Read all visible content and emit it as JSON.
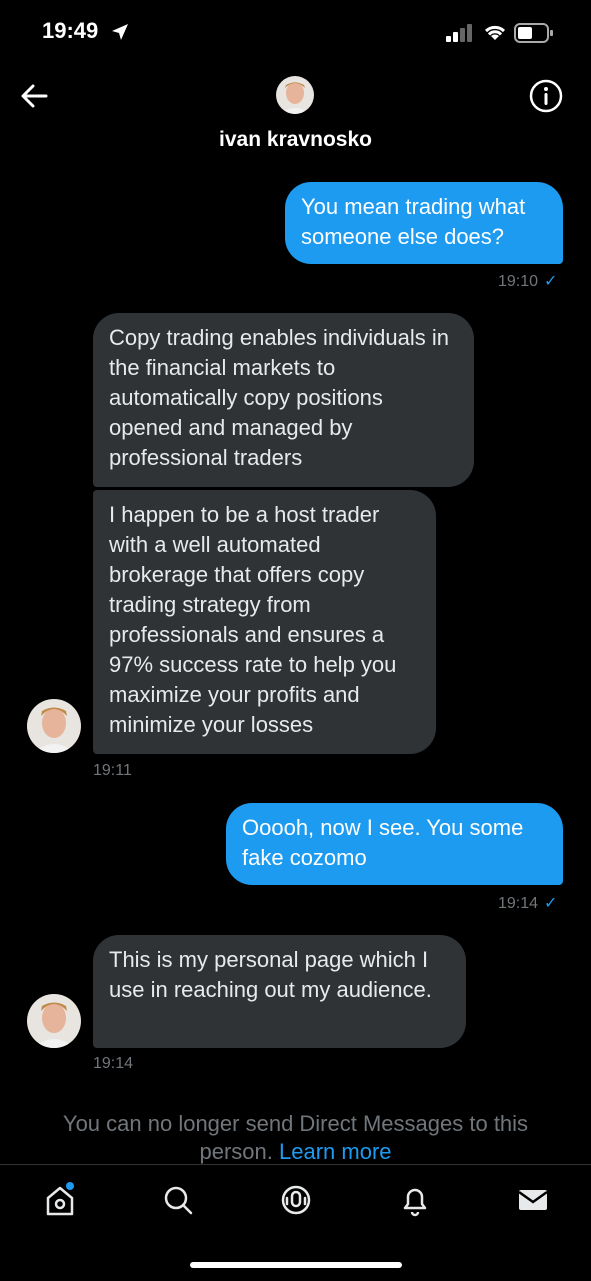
{
  "status_bar": {
    "time": "19:49"
  },
  "header": {
    "contact_name": "ivan kravnosko"
  },
  "messages": [
    {
      "direction": "out",
      "text": "You mean trading what someone else does?",
      "time": "19:10"
    },
    {
      "direction": "in",
      "text": "Copy trading enables individuals in the financial markets to automatically copy positions opened and managed by professional traders"
    },
    {
      "direction": "in",
      "text": "I happen to be a host trader with a well automated brokerage that offers copy trading strategy from professionals and ensures a 97% success rate to help you maximize your profits and minimize your losses",
      "time": "19:11"
    },
    {
      "direction": "out",
      "text": "Ooooh, now I see. You some fake cozomo",
      "time": "19:14"
    },
    {
      "direction": "in",
      "text": "This is my personal page which I use in reaching out my audience.",
      "time": "19:14"
    }
  ],
  "notice": {
    "text": "You can no longer send Direct Messages to this person.",
    "link": "Learn more"
  },
  "colors": {
    "accent": "#1d9bf0",
    "incoming_bubble": "#2f3336",
    "background": "#000000"
  },
  "icons": [
    "location-arrow-icon",
    "cellular-signal-icon",
    "wifi-icon",
    "battery-icon",
    "back-arrow-icon",
    "info-icon",
    "home-icon",
    "search-icon",
    "spaces-icon",
    "notifications-icon",
    "messages-icon"
  ]
}
